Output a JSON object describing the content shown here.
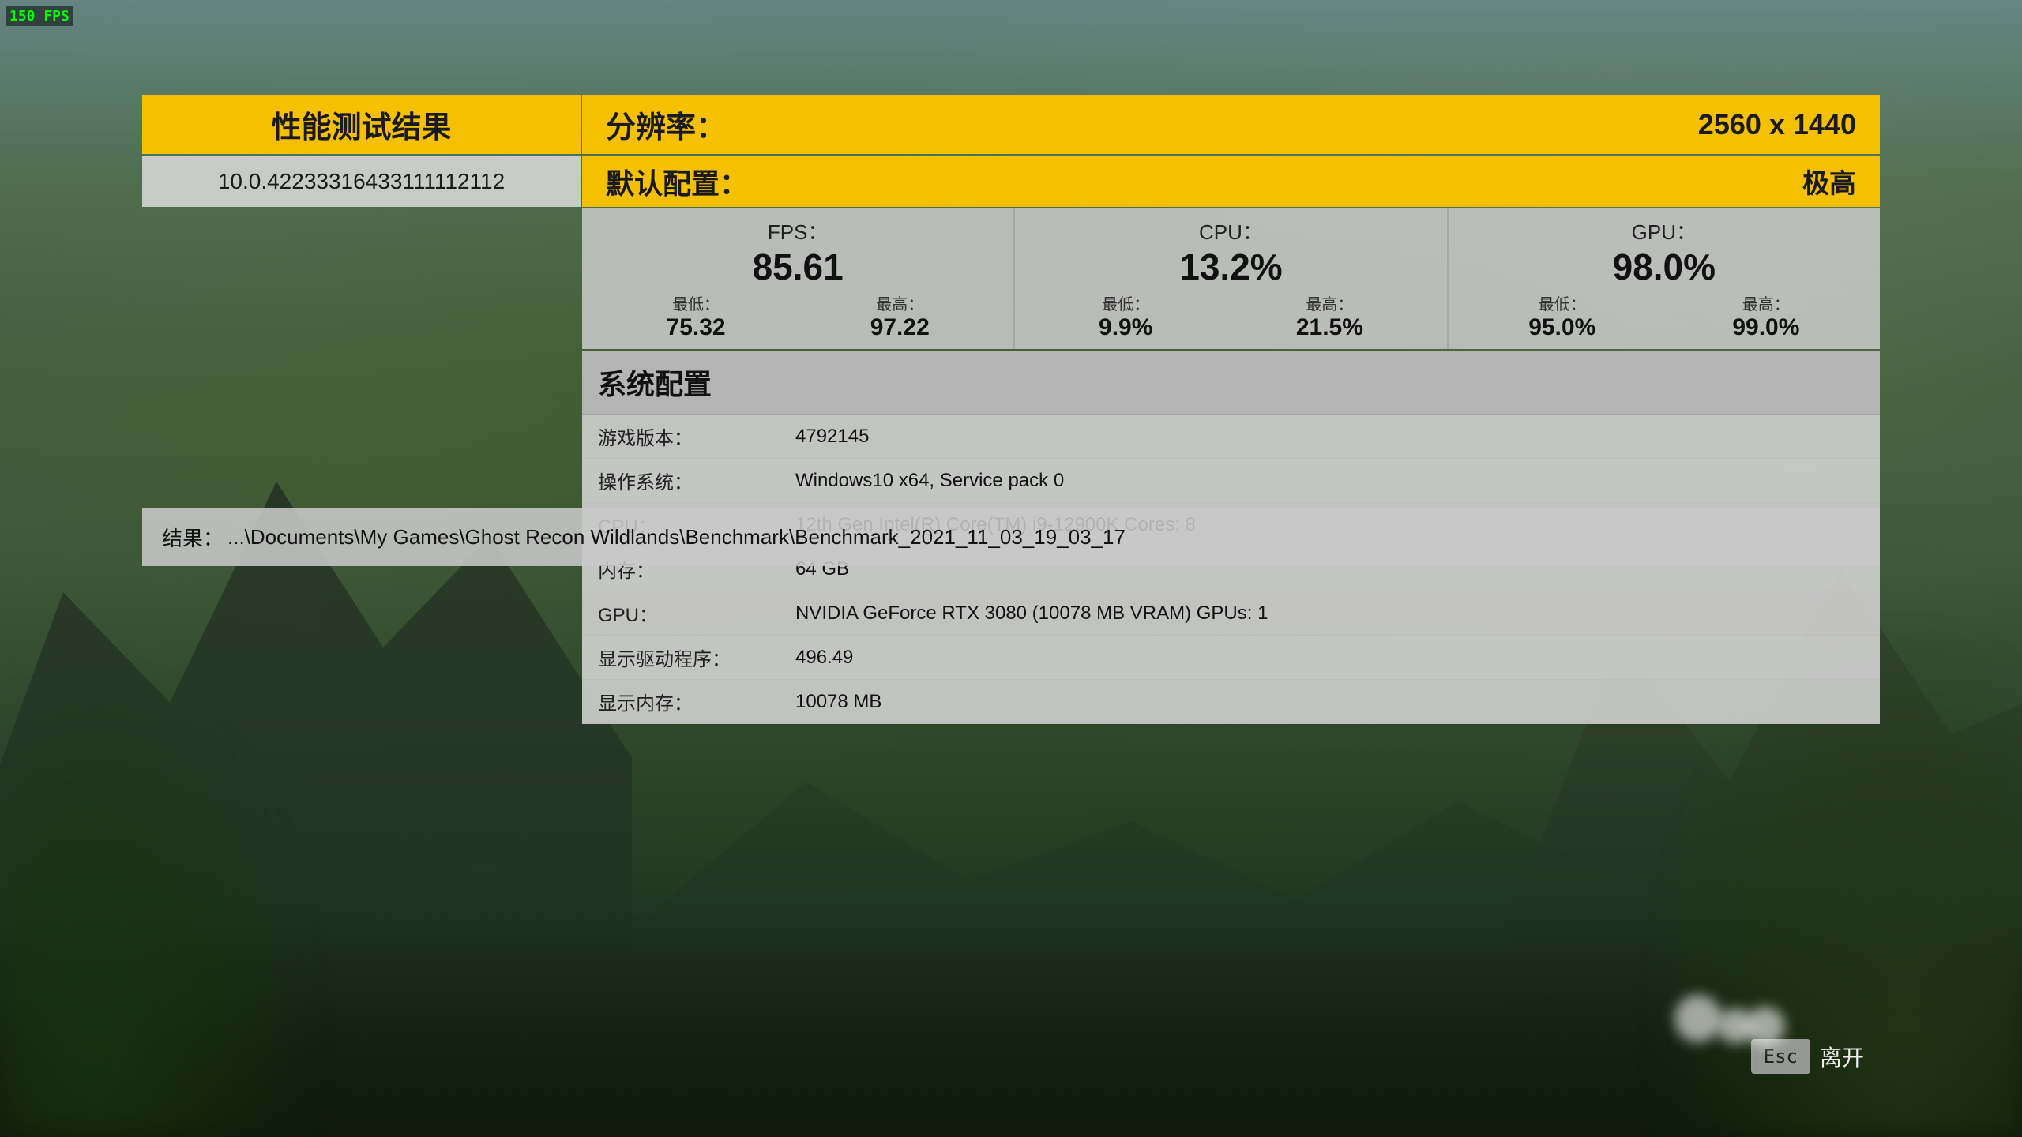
{
  "fps_counter": "150 FPS",
  "header": {
    "title_label": "性能测试结果",
    "resolution_label": "分辨率：",
    "resolution_value": "2560 x 1440"
  },
  "second_row": {
    "build_id": "10.0.42233316433111112112",
    "preset_label": "默认配置：",
    "preset_value": "极高"
  },
  "stats": {
    "fps": {
      "label": "FPS：",
      "main": "85.61",
      "min_label": "最低：",
      "min_value": "75.32",
      "max_label": "最高：",
      "max_value": "97.22"
    },
    "cpu": {
      "label": "CPU：",
      "main": "13.2%",
      "min_label": "最低：",
      "min_value": "9.9%",
      "max_label": "最高：",
      "max_value": "21.5%"
    },
    "gpu": {
      "label": "GPU：",
      "main": "98.0%",
      "min_label": "最低：",
      "min_value": "95.0%",
      "max_label": "最高：",
      "max_value": "99.0%"
    }
  },
  "sysconfig": {
    "title": "系统配置",
    "rows": [
      {
        "key": "游戏版本：",
        "value": "4792145"
      },
      {
        "key": "操作系统：",
        "value": "Windows10 x64, Service pack 0"
      },
      {
        "key": "CPU：",
        "value": "12th Gen Intel(R) Core(TM) i9-12900K Cores: 8"
      },
      {
        "key": "内存：",
        "value": "64 GB"
      },
      {
        "key": "GPU：",
        "value": "NVIDIA GeForce RTX 3080 (10078 MB VRAM) GPUs: 1"
      },
      {
        "key": "显示驱动程序：",
        "value": "496.49"
      },
      {
        "key": "显示内存：",
        "value": "10078 MB"
      }
    ]
  },
  "result": {
    "label": "结果：",
    "path": "...\\Documents\\My Games\\Ghost Recon Wildlands\\Benchmark\\Benchmark_2021_11_03_19_03_17"
  },
  "esc_button": {
    "key": "Esc",
    "label": "离开"
  },
  "colors": {
    "yellow": "#F5C000",
    "panel_bg": "rgba(200,200,200,0.88)",
    "text_dark": "#111111"
  }
}
